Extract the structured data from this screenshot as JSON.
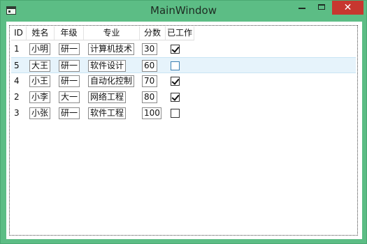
{
  "window": {
    "title": "MainWindow",
    "minimize_icon": "minimize-icon",
    "maximize_icon": "maximize-icon",
    "close_icon": "close-icon",
    "close_glyph": "✕"
  },
  "grid": {
    "columns": [
      "ID",
      "姓名",
      "年级",
      "专业",
      "分数",
      "已工作"
    ],
    "rows": [
      {
        "id": "1",
        "name": "小明",
        "grade": "研一",
        "major": "计算机技术",
        "score": "30",
        "employed": true
      },
      {
        "id": "5",
        "name": "大王",
        "grade": "研一",
        "major": "软件设计",
        "score": "60",
        "employed": false
      },
      {
        "id": "4",
        "name": "小王",
        "grade": "研一",
        "major": "自动化控制",
        "score": "70",
        "employed": true
      },
      {
        "id": "2",
        "name": "小李",
        "grade": "大一",
        "major": "网络工程",
        "score": "80",
        "employed": true
      },
      {
        "id": "3",
        "name": "小张",
        "grade": "研一",
        "major": "软件工程",
        "score": "100",
        "employed": false
      }
    ],
    "selected_row": 1
  },
  "colors": {
    "frame": "#5cbd85",
    "close_button": "#c7372f",
    "selection": "#e6f3fb"
  }
}
